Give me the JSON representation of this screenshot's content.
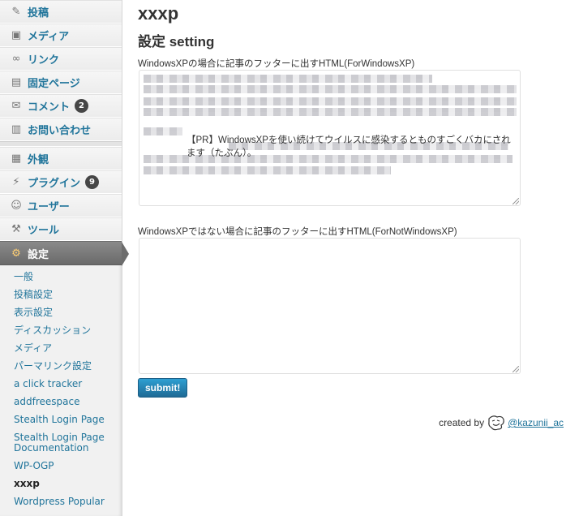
{
  "sidebar": {
    "items_top": [
      {
        "label": "投稿",
        "icon": "pushpin-icon"
      },
      {
        "label": "メディア",
        "icon": "media-icon"
      },
      {
        "label": "リンク",
        "icon": "link-icon"
      },
      {
        "label": "固定ページ",
        "icon": "page-icon"
      },
      {
        "label": "コメント",
        "icon": "comment-icon",
        "badge": "2"
      },
      {
        "label": "お問い合わせ",
        "icon": "contact-icon"
      }
    ],
    "items_bottom": [
      {
        "label": "外観",
        "icon": "appearance-icon"
      },
      {
        "label": "プラグイン",
        "icon": "plugin-icon",
        "badge": "9"
      },
      {
        "label": "ユーザー",
        "icon": "users-icon"
      },
      {
        "label": "ツール",
        "icon": "tools-icon"
      },
      {
        "label": "設定",
        "icon": "settings-icon"
      }
    ],
    "submenu": [
      "一般",
      "投稿設定",
      "表示設定",
      "ディスカッション",
      "メディア",
      "パーマリンク設定",
      "a click tracker",
      "addfreespace",
      "Stealth Login Page",
      "Stealth Login Page Documentation",
      "WP-OGP",
      "xxxp",
      "Wordpress Popular"
    ],
    "active_submenu": "xxxp"
  },
  "main": {
    "title": "xxxp",
    "subtitle": "設定 setting",
    "field1_label": "WindowsXPの場合に記事のフッターに出すHTML(ForWindowsXP)",
    "field1_visible_text": "【PR】WindowsXPを使い続けてウイルスに感染するとものすごくバカにされます（たぶん）。",
    "field2_label": "WindowsXPではない場合に記事のフッターに出すHTML(ForNotWindowsXP)",
    "field2_value": "",
    "submit_label": "submit!",
    "credit_prefix": "created by",
    "credit_link": "@kazunii_ac"
  },
  "colors": {
    "link": "#21759b",
    "active_menu_bg": "#6d6d6d",
    "submit_button": "#2388c0"
  }
}
